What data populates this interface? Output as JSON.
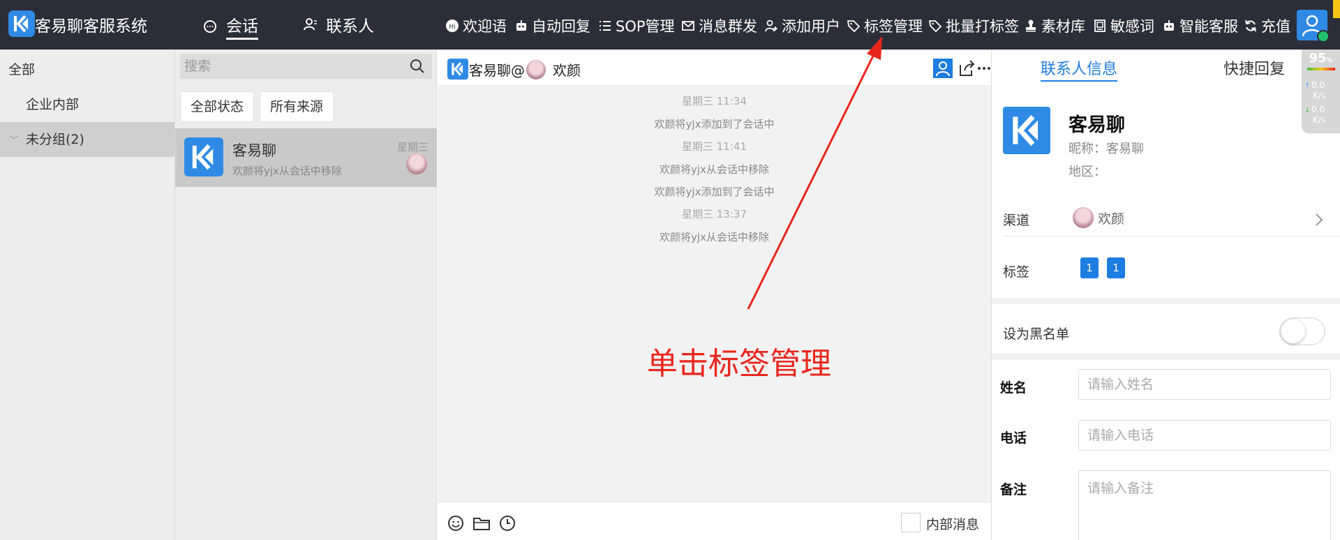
{
  "app": {
    "title": "客易聊客服系统"
  },
  "nav": {
    "tabs": [
      {
        "label": "会话",
        "active": true
      },
      {
        "label": "联系人",
        "active": false
      }
    ]
  },
  "toolbar": {
    "items": [
      {
        "label": "欢迎语",
        "icon": "hi-icon"
      },
      {
        "label": "自动回复",
        "icon": "robot-icon"
      },
      {
        "label": "SOP管理",
        "icon": "list-icon"
      },
      {
        "label": "消息群发",
        "icon": "mail-icon"
      },
      {
        "label": "添加用户",
        "icon": "add-user-icon"
      },
      {
        "label": "标签管理",
        "icon": "tag-icon"
      },
      {
        "label": "批量打标签",
        "icon": "tag-icon"
      },
      {
        "label": "素材库",
        "icon": "stamp-icon"
      },
      {
        "label": "敏感词",
        "icon": "document-icon"
      },
      {
        "label": "智能客服",
        "icon": "robot-icon"
      },
      {
        "label": "充值",
        "icon": "refresh-icon"
      }
    ]
  },
  "groups": {
    "items": [
      {
        "label": "全部"
      },
      {
        "label": "企业内部"
      },
      {
        "label": "未分组(2)"
      }
    ]
  },
  "sessions": {
    "search_placeholder": "搜索",
    "filters": [
      "全部状态",
      "所有来源"
    ],
    "items": [
      {
        "name": "客易聊",
        "preview": "欢颜将yjx从会话中移除",
        "time": "星期三"
      }
    ]
  },
  "chat": {
    "title_prefix": "客易聊@",
    "title_user": "欢颜",
    "messages": [
      {
        "type": "time",
        "text": "星期三 11:34"
      },
      {
        "type": "event",
        "text": "欢颜将yjx添加到了会话中"
      },
      {
        "type": "time",
        "text": "星期三 11:41"
      },
      {
        "type": "event",
        "text": "欢颜将yjx从会话中移除"
      },
      {
        "type": "event",
        "text": "欢颜将yjx添加到了会话中"
      },
      {
        "type": "time",
        "text": "星期三 13:37"
      },
      {
        "type": "event",
        "text": "欢颜将yjx从会话中移除"
      }
    ],
    "internal_label": "内部消息"
  },
  "annotation": {
    "text": "单击标签管理",
    "color": "#e8261c"
  },
  "contact": {
    "tabs": [
      "联系人信息",
      "快捷回复"
    ],
    "name": "客易聊",
    "nickname": "昵称：客易聊",
    "region": "地区：",
    "channel_label": "渠道",
    "channel_value": "欢颜",
    "tags_label": "标签",
    "tags": [
      "1",
      "1"
    ],
    "blacklist_label": "设为黑名单",
    "blacklist_on": false,
    "form": {
      "name_label": "姓名",
      "name_placeholder": "请输入姓名",
      "phone_label": "电话",
      "phone_placeholder": "请输入电话",
      "note_label": "备注",
      "note_placeholder": "请输入备注"
    }
  },
  "net_widget": {
    "percent": "95",
    "percent_unit": "%",
    "up": "0.0",
    "up_unit": "K/s",
    "down": "0.0",
    "down_unit": "K/s"
  },
  "colors": {
    "topbar": "#2b2e38",
    "accent": "#1e7de0",
    "brand": "#2f8ae6",
    "annotation": "#e8261c"
  }
}
